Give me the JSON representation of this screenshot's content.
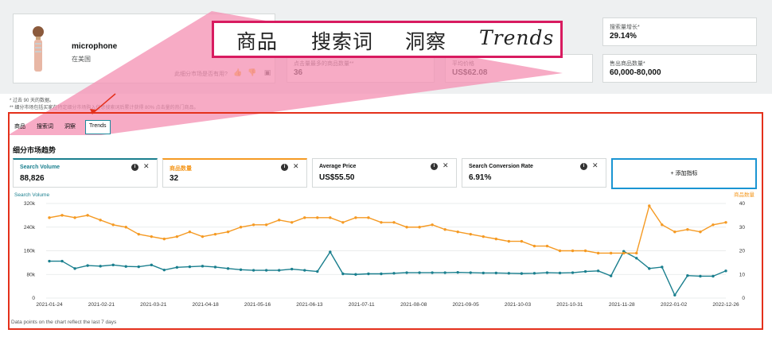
{
  "product": {
    "name": "microphone",
    "location": "在美国",
    "helpful_question": "此细分市场是否有用?"
  },
  "metrics_top": [
    {
      "label": "搜索量增长*",
      "value": "29.14%"
    },
    {
      "label": "点击量最多的商品数量**",
      "value": "36"
    },
    {
      "label": "平均价格",
      "value": "US$62.08"
    },
    {
      "label": "售出商品数量*",
      "value": "60,000-80,000"
    }
  ],
  "notes": {
    "line1": "* 过去 90 天的数据。",
    "line2": "** 细分市场包括买家在特定细分市场购入任意搜索词后累计获得 80% 点击量的热门商品。"
  },
  "banner": {
    "words": [
      "商品",
      "搜索词",
      "洞察",
      "Trends"
    ]
  },
  "tabs": [
    "商品",
    "搜索词",
    "洞察",
    "Trends"
  ],
  "section_title": "细分市场趋势",
  "kpis": [
    {
      "label": "Search Volume",
      "value": "88,826",
      "color": "#1a7f8e"
    },
    {
      "label": "商品数量",
      "value": "32",
      "color": "#f59a23"
    },
    {
      "label": "Average Price",
      "value": "US$55.50",
      "color": "#0f1111"
    },
    {
      "label": "Search Conversion Rate",
      "value": "6.91%",
      "color": "#0f1111"
    }
  ],
  "add_kpi_label": "+ 添加指标",
  "footnote": "Data points on the chart reflect the last 7 days",
  "chart_data": {
    "type": "line",
    "x": [
      "2021-01-24",
      "2021-01-31",
      "2021-02-07",
      "2021-02-14",
      "2021-02-21",
      "2021-02-28",
      "2021-03-07",
      "2021-03-14",
      "2021-03-21",
      "2021-03-28",
      "2021-04-04",
      "2021-04-11",
      "2021-04-18",
      "2021-04-25",
      "2021-05-02",
      "2021-05-09",
      "2021-05-16",
      "2021-05-23",
      "2021-05-30",
      "2021-06-06",
      "2021-06-13",
      "2021-06-20",
      "2021-06-27",
      "2021-07-04",
      "2021-07-11",
      "2021-07-18",
      "2021-07-25",
      "2021-08-01",
      "2021-08-08",
      "2021-08-15",
      "2021-08-22",
      "2021-08-29",
      "2021-09-05",
      "2021-09-12",
      "2021-09-19",
      "2021-09-26",
      "2021-10-03",
      "2021-10-10",
      "2021-10-17",
      "2021-10-24",
      "2021-10-31",
      "2021-11-07",
      "2021-11-14",
      "2021-11-21",
      "2021-11-28",
      "2021-12-05",
      "2021-12-12",
      "2021-12-19",
      "2021-12-26",
      "2022-01-02",
      "2022-01-09",
      "2022-01-16",
      "2022-01-23",
      "2022-01-30"
    ],
    "x_tick_labels": [
      "2021-01-24",
      "2021-02-21",
      "2021-03-21",
      "2021-04-18",
      "2021-05-16",
      "2021-06-13",
      "2021-07-11",
      "2021-08-08",
      "2021-09-05",
      "2021-10-03",
      "2021-10-31",
      "2021-11-28",
      "2022-01-02",
      "2022-12-26"
    ],
    "series": [
      {
        "name": "Search Volume",
        "axis": "left",
        "color": "#1a7f8e",
        "values": [
          125000,
          125000,
          100000,
          110000,
          108000,
          112000,
          107000,
          106000,
          112000,
          95000,
          104000,
          106000,
          108000,
          105000,
          100000,
          96000,
          94000,
          94000,
          94000,
          98000,
          94000,
          90000,
          156000,
          82000,
          80000,
          82000,
          82000,
          84000,
          86000,
          86000,
          86000,
          86000,
          87000,
          86000,
          85000,
          85000,
          84000,
          83000,
          84000,
          86000,
          85000,
          86000,
          90000,
          92000,
          75000,
          158000,
          135000,
          100000,
          105000,
          10000,
          76000,
          74000,
          74000,
          92000
        ]
      },
      {
        "name": "商品数量",
        "axis": "right",
        "color": "#f59a23",
        "values": [
          34,
          35,
          34,
          35,
          33,
          31,
          30,
          27,
          26,
          25,
          26,
          28,
          26,
          27,
          28,
          30,
          31,
          31,
          33,
          32,
          34,
          34,
          34,
          32,
          34,
          34,
          32,
          32,
          30,
          30,
          31,
          29,
          28,
          27,
          26,
          25,
          24,
          24,
          22,
          22,
          20,
          20,
          20,
          19,
          19,
          19,
          19,
          39,
          31,
          28,
          29,
          28,
          31,
          32
        ]
      }
    ],
    "left_axis": {
      "label": "Search Volume",
      "ticks": [
        "320k",
        "240k",
        "160k",
        "80k",
        "0"
      ],
      "range": [
        0,
        320000
      ]
    },
    "right_axis": {
      "label": "商品数量",
      "ticks": [
        "40",
        "30",
        "20",
        "10",
        "0"
      ],
      "range": [
        0,
        40
      ]
    },
    "grid": true
  }
}
